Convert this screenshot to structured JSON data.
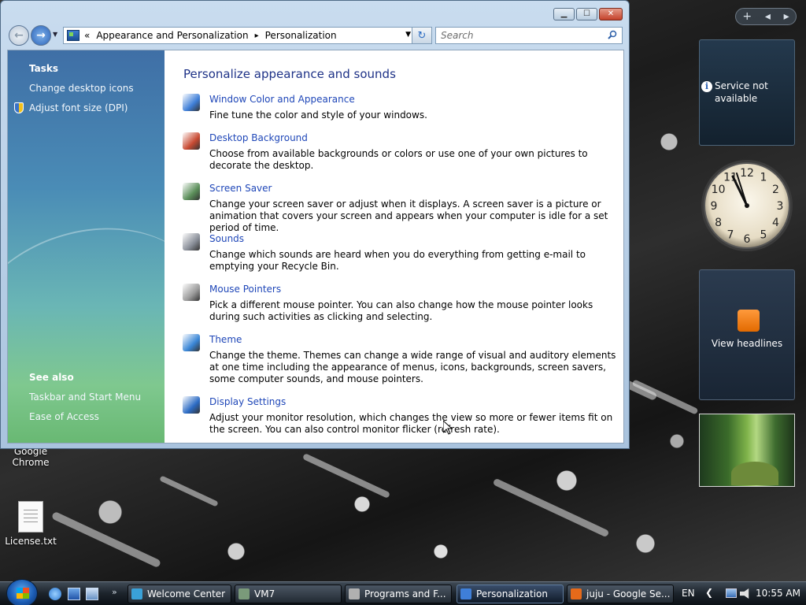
{
  "window": {
    "minimize_glyph": "▁",
    "maximize_glyph": "☐",
    "close_glyph": "✕"
  },
  "nav": {
    "back_glyph": "←",
    "forward_glyph": "→",
    "recent_glyph": "▼",
    "breadcrumb_prefix": "«",
    "breadcrumb": [
      "Appearance and Personalization",
      "Personalization"
    ],
    "breadcrumb_sep": "▸",
    "address_dropdown_glyph": "▼",
    "refresh_glyph": "↻",
    "search_placeholder": "Search"
  },
  "left_pane": {
    "tasks_heading": "Tasks",
    "tasks": [
      "Change desktop icons",
      "Adjust font size (DPI)"
    ],
    "see_also_heading": "See also",
    "see_also": [
      "Taskbar and Start Menu",
      "Ease of Access"
    ]
  },
  "main": {
    "title": "Personalize appearance and sounds",
    "items": [
      {
        "icon": "window-color-icon",
        "color": "#3f7fd8",
        "label": "Window Color and Appearance",
        "desc": "Fine tune the color and style of your windows."
      },
      {
        "icon": "desktop-background-icon",
        "color": "#c84a32",
        "label": "Desktop Background",
        "desc": "Choose from available backgrounds or colors or use one of your own pictures to decorate the desktop."
      },
      {
        "icon": "screen-saver-icon",
        "color": "#5b8f5a",
        "label": "Screen Saver",
        "desc": "Change your screen saver or adjust when it displays. A screen saver is a picture or animation that covers your screen and appears when your computer is idle for a set period of time."
      },
      {
        "icon": "sounds-icon",
        "color": "#8a8f99",
        "label": "Sounds",
        "desc": "Change which sounds are heard when you do everything from getting e-mail to emptying your Recycle Bin."
      },
      {
        "icon": "mouse-pointers-icon",
        "color": "#9a9a9a",
        "label": "Mouse Pointers",
        "desc": "Pick a different mouse pointer. You can also change how the mouse pointer looks during such activities as clicking and selecting."
      },
      {
        "icon": "theme-icon",
        "color": "#3a86d6",
        "label": "Theme",
        "desc": "Change the theme. Themes can change a wide range of visual and auditory elements at one time including the appearance of menus, icons, backgrounds, screen savers, some computer sounds, and mouse pointers."
      },
      {
        "icon": "display-settings-icon",
        "color": "#2c6bc4",
        "label": "Display Settings",
        "desc": "Adjust your monitor resolution, which changes the view so more or fewer items fit on the screen. You can also control monitor flicker (refresh rate)."
      }
    ]
  },
  "sidebar": {
    "toolbar_add": "+",
    "toolbar_prev": "◂",
    "toolbar_next": "▸",
    "service_message": "Service not available",
    "info_glyph": "i",
    "feed_label": "View headlines",
    "clock_numbers": [
      "12",
      "1",
      "2",
      "3",
      "4",
      "5",
      "6",
      "7",
      "8",
      "9",
      "10",
      "11"
    ]
  },
  "desktop_icons": [
    {
      "label": "Google Chrome"
    },
    {
      "label": "License.txt"
    }
  ],
  "taskbar": {
    "quicklaunch_more": "»",
    "tasks": [
      {
        "label": "Welcome Center",
        "icon": "welcome-center-icon",
        "color": "#3aa1d8"
      },
      {
        "label": "VM7",
        "icon": "folder-icon",
        "color": "#7a9a7a"
      },
      {
        "label": "Programs and F...",
        "icon": "programs-icon",
        "color": "#b0b0b0"
      },
      {
        "label": "Personalization",
        "icon": "personalization-icon",
        "color": "#3f7fd8"
      },
      {
        "label": "juju - Google Se...",
        "icon": "firefox-icon",
        "color": "#e66a1a"
      }
    ],
    "language": "EN",
    "tray_expand": "❮",
    "clock": "10:55 AM"
  }
}
